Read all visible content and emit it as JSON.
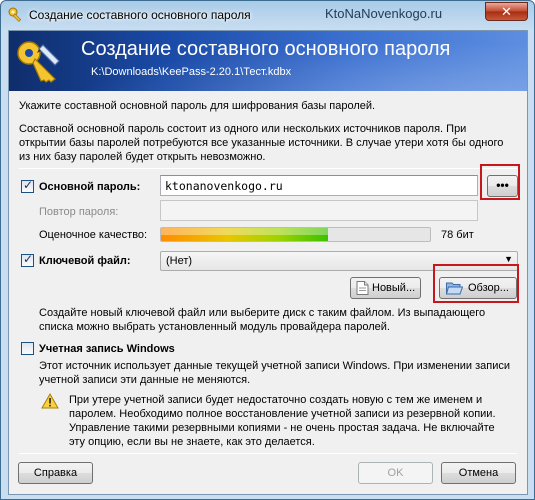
{
  "window": {
    "title": "Создание составного основного пароля",
    "watermark": "KtoNaNovenkogo.ru",
    "close_glyph": "✕"
  },
  "banner": {
    "title": "Создание составного основного пароля",
    "subtitle": "K:\\Downloads\\KeePass-2.20.1\\Тест.kdbx"
  },
  "intro": {
    "line1": "Укажите составной основной пароль для шифрования базы паролей.",
    "line2": "Составной основной пароль состоит из одного или нескольких источников пароля. При",
    "line3": "открытии базы паролей потребуются все указанные источники. В случае утери хотя бы одного",
    "line4": "из них базу паролей будет открыть невозможно."
  },
  "master_password": {
    "checked": true,
    "label": "Основной пароль:",
    "value": "ktonanovenkogo.ru",
    "dots_label": "•••",
    "repeat_label": "Повтор пароля:",
    "repeat_value": "",
    "quality_label": "Оценочное качество:",
    "quality_percent": 62,
    "quality_value": "78 бит"
  },
  "key_file": {
    "checked": true,
    "label": "Ключевой файл:",
    "selected": "(Нет)",
    "new_button": "Новый...",
    "browse_button": "Обзор...",
    "desc1": "Создайте новый ключевой файл или выберите диск с таким файлом. Из выпадающего",
    "desc2": "списка можно выбрать установленный модуль провайдера паролей."
  },
  "windows_account": {
    "checked": false,
    "label": "Учетная запись Windows",
    "desc1": "Этот источник использует данные текущей учетной записи Windows. При изменении записи",
    "desc2": "учетной записи эти данные не меняются.",
    "warn1": "При утере учетной записи будет недостаточно создать новую с тем же именем и",
    "warn2": "паролем. Необходимо полное восстановление учетной записи из резервной копии.",
    "warn3": "Управление такими резервными копиями - не очень простая задача. Не включайте",
    "warn4": "эту опцию, если вы не знаете, как это делается."
  },
  "footer": {
    "help_button": "Справка",
    "ok_button": "OK",
    "cancel_button": "Отмена"
  },
  "colors": {
    "highlight": "#c8161d",
    "banner_dark": "#0f2d6b",
    "banner_light": "#5d8ee0"
  },
  "icons": {
    "app": "keepass-key-icon",
    "banner": "key-pen-icon",
    "browse": "folder-open-icon",
    "warning": "warning-icon"
  }
}
